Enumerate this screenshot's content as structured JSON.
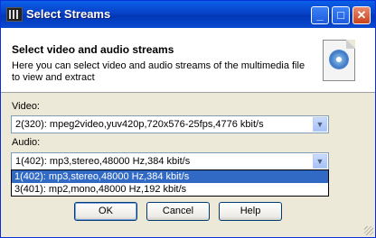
{
  "window": {
    "title": "Select Streams",
    "minimize_glyph": "_",
    "maximize_glyph": "□",
    "close_glyph": "✕"
  },
  "header": {
    "title": "Select video and audio streams",
    "description": "Here you can select video and audio streams of the multimedia file to view and extract",
    "icon": "media-file-icon"
  },
  "video": {
    "label": "Video:",
    "selected": "2(320): mpeg2video,yuv420p,720x576-25fps,4776 kbit/s"
  },
  "audio": {
    "label": "Audio:",
    "selected": "1(402): mp3,stereo,48000 Hz,384 kbit/s",
    "options": [
      "1(402): mp3,stereo,48000 Hz,384 kbit/s",
      "3(401): mp2,mono,48000 Hz,192 kbit/s"
    ]
  },
  "buttons": {
    "ok": "OK",
    "cancel": "Cancel",
    "help": "Help"
  },
  "colors": {
    "titlebar": "#0842c8",
    "selection": "#316ac5",
    "dialog_bg": "#ece9d8"
  }
}
